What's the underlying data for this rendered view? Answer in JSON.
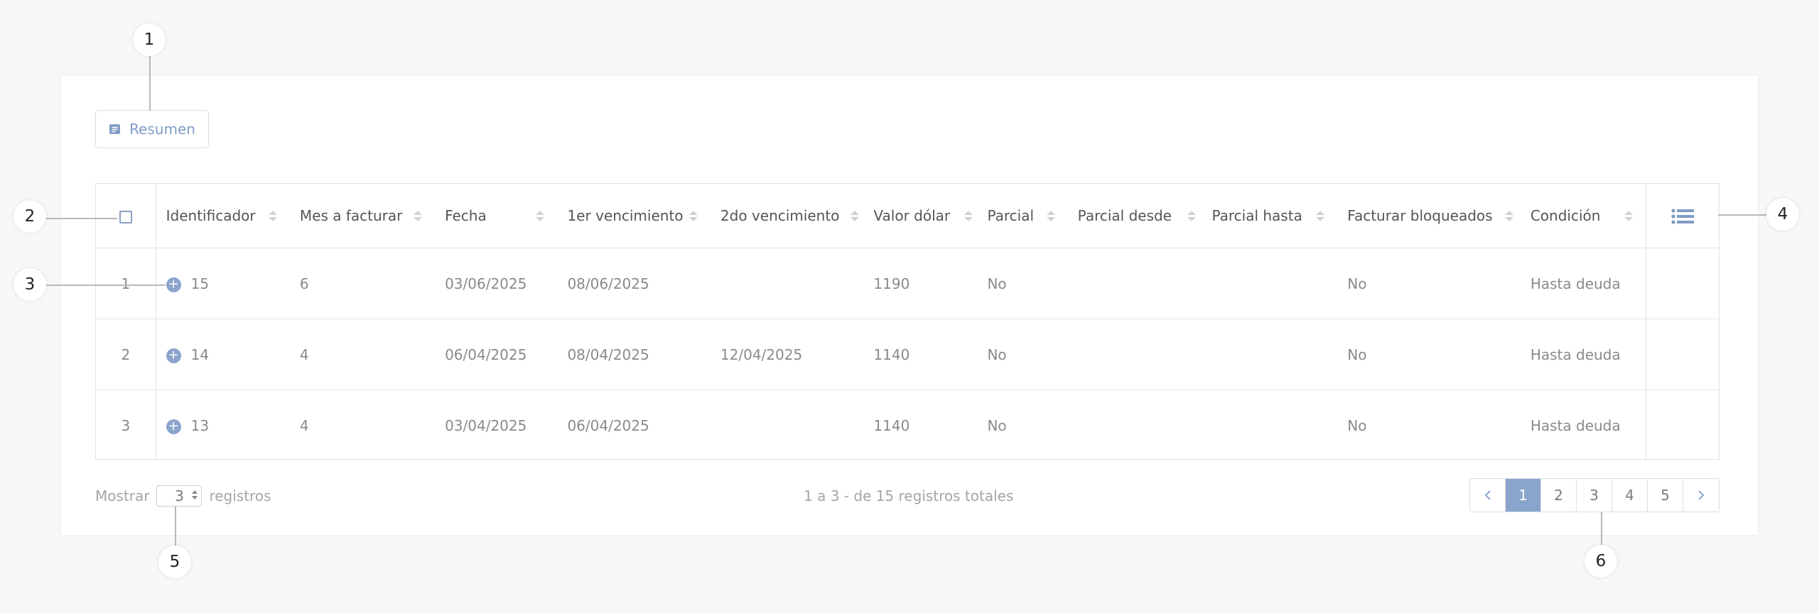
{
  "toolbar": {
    "resumen_label": "Resumen"
  },
  "table": {
    "columns": [
      "Identificador",
      "Mes a facturar",
      "Fecha",
      "1er vencimiento",
      "2do vencimiento",
      "Valor dólar",
      "Parcial",
      "Parcial desde",
      "Parcial hasta",
      "Facturar bloqueados",
      "Condición"
    ],
    "rows": [
      {
        "num": "1",
        "identificador": "15",
        "mes": "6",
        "fecha": "03/06/2025",
        "venc1": "08/06/2025",
        "venc2": "",
        "dolar": "1190",
        "parcial": "No",
        "desde": "",
        "hasta": "",
        "bloqueados": "No",
        "condicion": "Hasta deuda"
      },
      {
        "num": "2",
        "identificador": "14",
        "mes": "4",
        "fecha": "06/04/2025",
        "venc1": "08/04/2025",
        "venc2": "12/04/2025",
        "dolar": "1140",
        "parcial": "No",
        "desde": "",
        "hasta": "",
        "bloqueados": "No",
        "condicion": "Hasta deuda"
      },
      {
        "num": "3",
        "identificador": "13",
        "mes": "4",
        "fecha": "03/04/2025",
        "venc1": "06/04/2025",
        "venc2": "",
        "dolar": "1140",
        "parcial": "No",
        "desde": "",
        "hasta": "",
        "bloqueados": "No",
        "condicion": "Hasta deuda"
      }
    ]
  },
  "footer": {
    "show_label": "Mostrar",
    "page_size": "3",
    "records_label": "registros",
    "summary": "1 a 3 - de 15 registros totales"
  },
  "pagination": {
    "pages": [
      "1",
      "2",
      "3",
      "4",
      "5"
    ],
    "active": "1"
  },
  "callouts": [
    "1",
    "2",
    "3",
    "4",
    "5",
    "6"
  ],
  "colors": {
    "accent": "#8aa4cc",
    "border": "#e3e3e3"
  },
  "icons": {
    "resumen": "receipt-icon",
    "add": "plus-circle-icon",
    "columns": "list-menu-icon",
    "prev": "chevron-left-icon",
    "next": "chevron-right-icon"
  }
}
